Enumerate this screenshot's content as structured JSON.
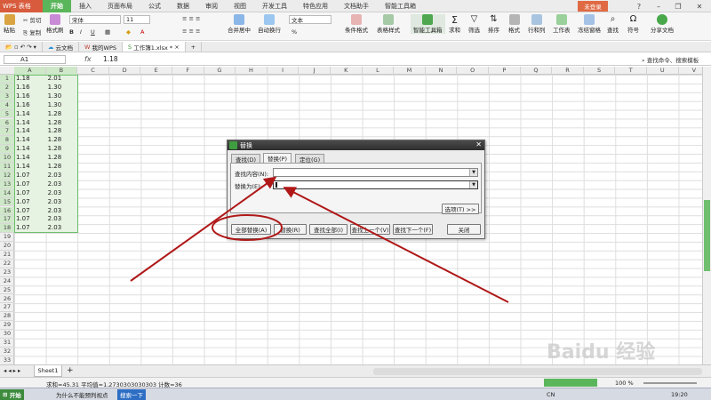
{
  "app": {
    "name": "WPS 表格",
    "login": "未登录"
  },
  "menu": [
    "开始",
    "插入",
    "页面布局",
    "公式",
    "数据",
    "审阅",
    "视图",
    "开发工具",
    "特色应用",
    "文档助手",
    "智能工具箱"
  ],
  "ribbon": {
    "paste": "粘贴",
    "cut": "剪切",
    "copy": "复制",
    "format_painter": "格式刷",
    "font_name": "宋体",
    "font_size": "11",
    "merge_center": "合并居中",
    "auto_wrap": "自动换行",
    "number_format": "文本",
    "percent": "%",
    "conditional_format": "条件格式",
    "table_style": "表格样式",
    "smart_toolbox": "智能工具箱",
    "sum": "求和",
    "filter": "筛选",
    "sort": "排序",
    "format": "格式",
    "rows_cols": "行和列",
    "worksheet": "工作表",
    "freeze": "冻结窗格",
    "find": "查找",
    "symbol": "符号",
    "share": "分享文档"
  },
  "doc_tabs": [
    "云文档",
    "我的WPS",
    "工作簿1.xlsx *"
  ],
  "formula_bar": {
    "cell_ref": "A1",
    "fx": "fx",
    "value": "1.18",
    "search_hint": "查找命令、搜索模板"
  },
  "columns": [
    "A",
    "B",
    "C",
    "D",
    "E",
    "F",
    "G",
    "H",
    "I",
    "J",
    "K",
    "L",
    "M",
    "N",
    "O",
    "P",
    "Q",
    "R",
    "S",
    "T",
    "U",
    "V"
  ],
  "rows": [
    "1",
    "2",
    "3",
    "4",
    "5",
    "6",
    "7",
    "8",
    "9",
    "10",
    "11",
    "12",
    "13",
    "14",
    "15",
    "16",
    "17",
    "18",
    "19",
    "20",
    "21",
    "22",
    "23",
    "24",
    "25",
    "26",
    "27",
    "28",
    "29",
    "30",
    "31",
    "32",
    "33"
  ],
  "data": [
    [
      "1.18",
      "2.01"
    ],
    [
      "1.16",
      "1.30"
    ],
    [
      "1.16",
      "1.30"
    ],
    [
      "1.16",
      "1.30"
    ],
    [
      "1.14",
      "1.28"
    ],
    [
      "1.14",
      "1.28"
    ],
    [
      "1.14",
      "1.28"
    ],
    [
      "1.14",
      "1.28"
    ],
    [
      "1.14",
      "1.28"
    ],
    [
      "1.14",
      "1.28"
    ],
    [
      "1.14",
      "1.28"
    ],
    [
      "1.07",
      "2.03"
    ],
    [
      "1.07",
      "2.03"
    ],
    [
      "1.07",
      "2.03"
    ],
    [
      "1.07",
      "2.03"
    ],
    [
      "1.07",
      "2.03"
    ],
    [
      "1.07",
      "2.03"
    ],
    [
      "1.07",
      "2.03"
    ]
  ],
  "sheet": {
    "tab": "Sheet1",
    "add": "+"
  },
  "status": {
    "text": "求和=45.31   平均值=1.2730303030303   计数=36",
    "zoom": "100 %"
  },
  "dialog": {
    "title": "替换",
    "tabs": [
      "查找(D)",
      "替换(P)",
      "定位(G)"
    ],
    "find_label": "查找内容(N):",
    "replace_label": "替换为(E):",
    "find_value": "",
    "replace_value": "",
    "options": "选项(T) >>",
    "buttons": [
      "全部替换(A)",
      "替换(R)",
      "查找全部(I)",
      "查找上一个(V)",
      "查找下一个(F)",
      "关闭"
    ]
  },
  "taskbar": {
    "start": "开始",
    "item1": "为什么不能预判视点",
    "search_btn": "搜索一下",
    "time": "19:20",
    "lang": "CN"
  },
  "watermark": "Baidu 经验",
  "colors": {
    "accent_green": "#5bb65b",
    "selection_fill": "#e6f3e2",
    "annotation_red": "#b01818"
  }
}
